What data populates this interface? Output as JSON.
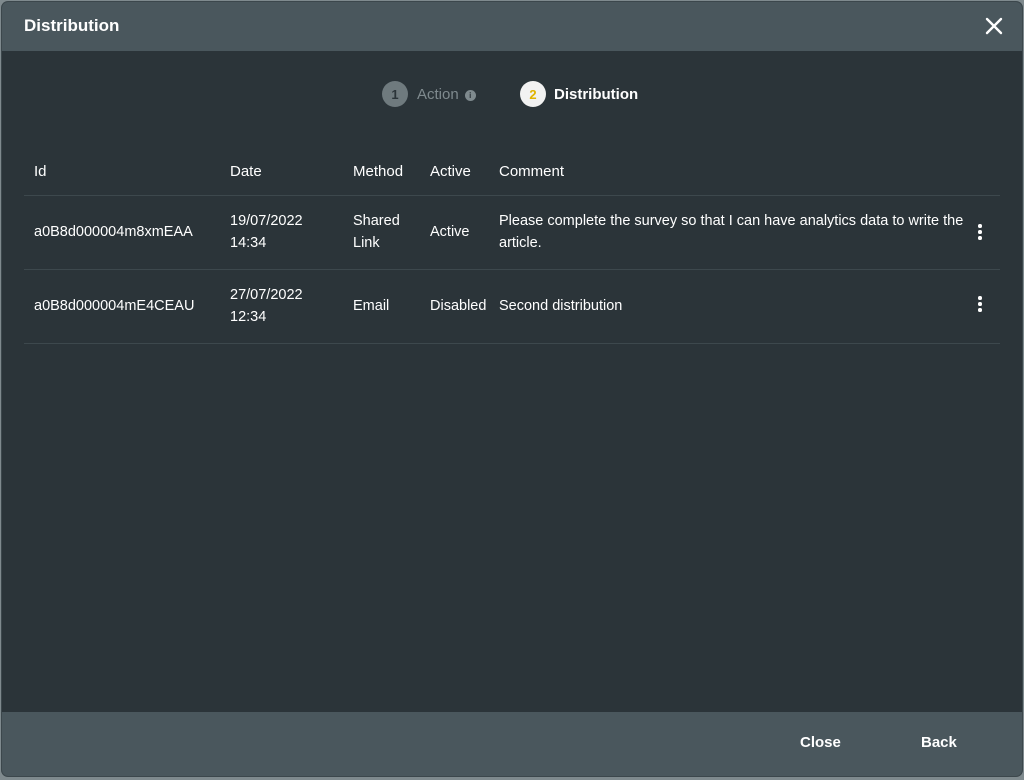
{
  "dialog": {
    "title": "Distribution",
    "close_icon": "close-icon"
  },
  "stepper": {
    "steps": [
      {
        "number": "1",
        "label": "Action",
        "state": "inactive",
        "info_icon": "info-icon"
      },
      {
        "number": "2",
        "label": "Distribution",
        "state": "active"
      }
    ]
  },
  "table": {
    "columns": [
      "Id",
      "Date",
      "Method",
      "Active",
      "Comment"
    ],
    "rows": [
      {
        "id": "a0B8d000004m8xmEAA",
        "date": "19/07/2022",
        "time": "14:34",
        "method_line1": "Shared",
        "method_line2": "Link",
        "active": "Active",
        "comment": "Please complete the survey so that I can have analytics data to write the article.",
        "menu_icon": "more-vertical-icon"
      },
      {
        "id": "a0B8d000004mE4CEAU",
        "date": "27/07/2022",
        "time": "12:34",
        "method_line1": "Email",
        "method_line2": "",
        "active": "Disabled",
        "comment": "Second distribution",
        "menu_icon": "more-vertical-icon"
      }
    ]
  },
  "footer": {
    "close_label": "Close",
    "back_label": "Back"
  },
  "colors": {
    "header_bg": "#4a575d",
    "body_bg": "#2b3439",
    "active_step_number": "#e0b400"
  }
}
